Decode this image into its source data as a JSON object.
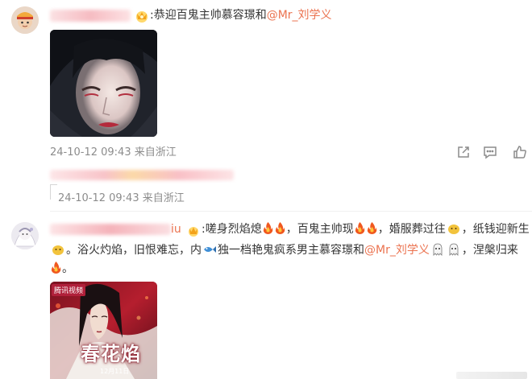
{
  "comment1": {
    "text_prefix": ":恭迎百鬼主帅慕容璟和",
    "mention": "@Mr_刘学义",
    "timestamp": "24-10-12 09:43",
    "location": "来自浙江"
  },
  "comment2": {
    "timestamp": "24-10-12 09:43",
    "location": "来自浙江"
  },
  "comment3": {
    "name_visible_tail": "iu",
    "line1_a": ":嗟身烈焰熄",
    "line1_b": "，百鬼主帅现",
    "line1_c": "，婚服葬过往",
    "line1_d": "，纸钱迎新生",
    "line2_a": "。浴火灼焰，旧恨难忘，内",
    "line2_b": "独一档艳鬼疯系男主慕容璟和",
    "line2_mention": "@Mr_刘学义",
    "line2_c": "，涅槃归来",
    "line3_end": "。",
    "poster_badge": "腾讯视频",
    "poster_title": "春花焰",
    "poster_sub": "12月11日"
  },
  "icons": [
    "share-icon",
    "comment-icon",
    "like-icon"
  ],
  "colors": {
    "mention": "#eb7350",
    "meta": "#8c8c8c",
    "blur_pink": "#f6b8be",
    "blur_yellow": "#f7cf6a"
  }
}
